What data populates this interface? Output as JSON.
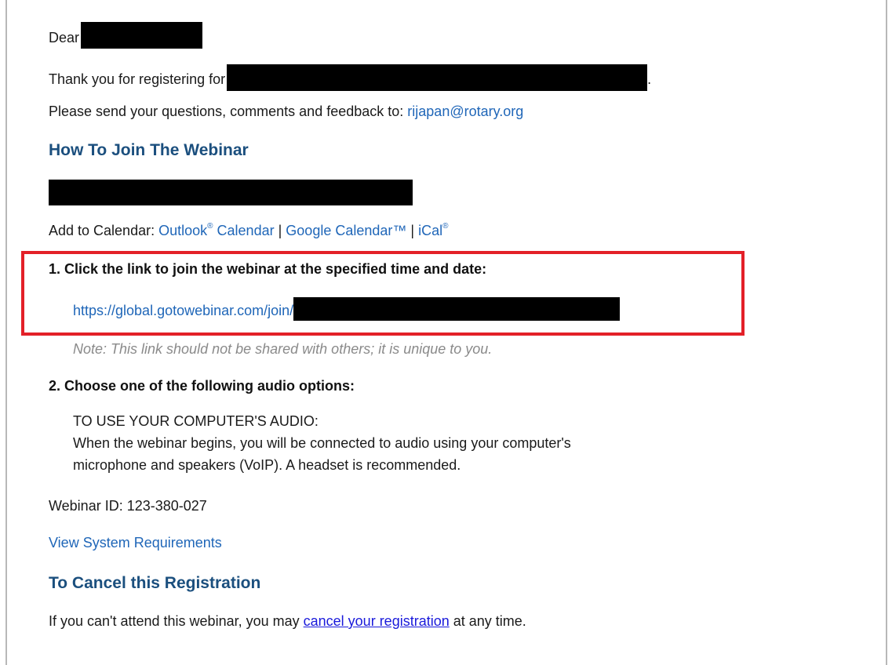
{
  "greeting": {
    "dear": "Dear",
    "thanks_prefix": "Thank you for registering for",
    "thanks_suffix": "."
  },
  "contact": {
    "prefix": "Please send your questions, comments and feedback to:",
    "email": "rijapan@rotary.org"
  },
  "join_section": {
    "heading": "How To Join The Webinar",
    "calendar_prefix": "Add to Calendar:",
    "outlook": "Outlook",
    "outlook_mark": "®",
    "outlook_suffix": " Calendar",
    "separator": "|",
    "google": "Google Calendar™",
    "ical": "iCal",
    "ical_mark": "®"
  },
  "step1": {
    "title": "1. Click the link to join the webinar at the specified time and date:",
    "url_prefix": "https://global.gotowebinar.com/join/",
    "note": "Note: This link should not be shared with others; it is unique to you."
  },
  "step2": {
    "title": "2. Choose one of the following audio options:",
    "option_title": "TO USE YOUR COMPUTER'S AUDIO:",
    "line1": "When the webinar begins, you will be connected to audio using your computer's",
    "line2": "microphone and speakers (VoIP). A headset is recommended."
  },
  "webinar": {
    "id_text": "Webinar ID: 123-380-027",
    "system_requirements": "View System Requirements"
  },
  "cancel_section": {
    "heading": "To Cancel this Registration",
    "prefix": "If you can't attend this webinar, you may",
    "link": "cancel your registration",
    "suffix": "at any time."
  },
  "colors": {
    "heading": "#1b4f7e",
    "link": "#1f66b8",
    "highlight": "#e32028",
    "redaction": "#000000"
  }
}
